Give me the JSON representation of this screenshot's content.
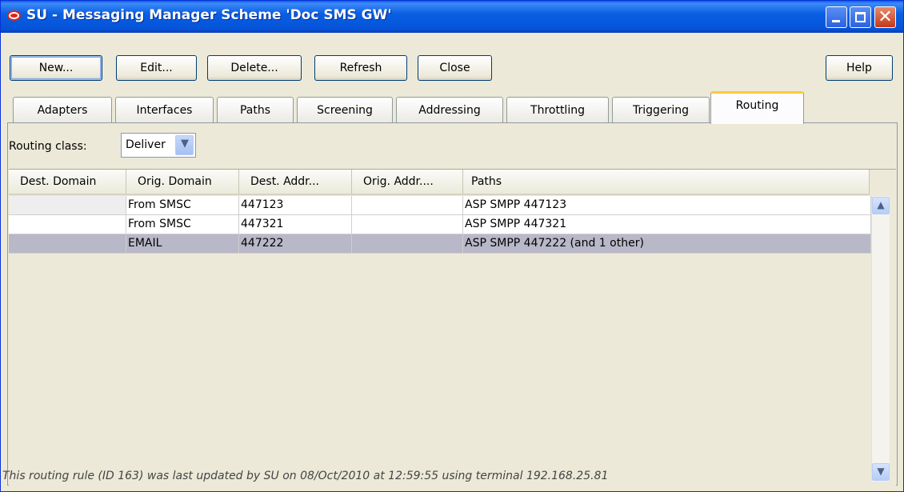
{
  "window": {
    "title": "SU - Messaging Manager Scheme 'Doc SMS GW'",
    "close_glyph": "✕"
  },
  "toolbar": {
    "new_label": "New...",
    "edit_label": "Edit...",
    "delete_label": "Delete...",
    "refresh_label": "Refresh",
    "close_label": "Close",
    "help_label": "Help"
  },
  "tabs": [
    {
      "label": "Adapters",
      "active": false
    },
    {
      "label": "Interfaces",
      "active": false
    },
    {
      "label": "Paths",
      "active": false
    },
    {
      "label": "Screening",
      "active": false
    },
    {
      "label": "Addressing",
      "active": false
    },
    {
      "label": "Throttling",
      "active": false
    },
    {
      "label": "Triggering",
      "active": false
    },
    {
      "label": "Routing",
      "active": true
    }
  ],
  "routing": {
    "class_label": "Routing class:",
    "class_value": "Deliver",
    "arrow_glyph": "▼"
  },
  "table": {
    "columns": [
      "Dest. Domain",
      "Orig. Domain",
      "Dest. Addr...",
      "Orig. Addr....",
      "Paths"
    ],
    "rows": [
      {
        "dest_domain": "",
        "orig_domain": "From SMSC",
        "dest_addr": "447123",
        "orig_addr": "",
        "paths": "ASP SMPP 447123"
      },
      {
        "dest_domain": "",
        "orig_domain": "From SMSC",
        "dest_addr": "447321",
        "orig_addr": "",
        "paths": "ASP SMPP 447321"
      },
      {
        "dest_domain": "",
        "orig_domain": "EMAIL",
        "dest_addr": "447222",
        "orig_addr": "",
        "paths": "ASP SMPP 447222 (and 1 other)"
      }
    ]
  },
  "scrollbar": {
    "up_glyph": "▲",
    "down_glyph": "▼"
  },
  "status": {
    "text": "This routing rule (ID 163) was last updated by SU on 08/Oct/2010 at 12:59:55 using terminal 192.168.25.81"
  }
}
